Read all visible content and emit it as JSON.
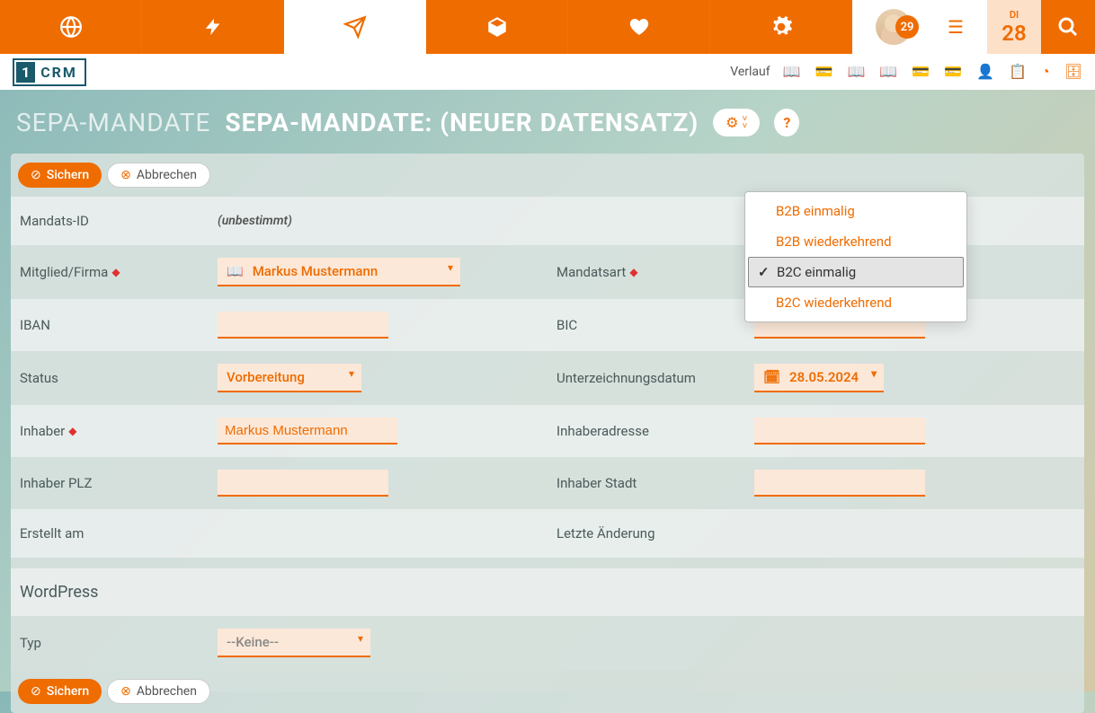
{
  "topnav": {
    "badge": "29",
    "date_dow": "DI",
    "date_day": "28"
  },
  "subbar": {
    "logo_box": "1",
    "logo_text": "CRM",
    "verlauf": "Verlauf"
  },
  "title": {
    "module": "SEPA-MANDATE",
    "record": "SEPA-MANDATE: (NEUER DATENSATZ)"
  },
  "actions": {
    "save": "Sichern",
    "cancel": "Abbrechen"
  },
  "form": {
    "mandate_id_label": "Mandats-ID",
    "mandate_id_value": "(unbestimmt)",
    "member_label": "Mitglied/Firma",
    "member_value": "Markus Mustermann",
    "mandatsart_label": "Mandatsart",
    "iban_label": "IBAN",
    "bic_label": "BIC",
    "status_label": "Status",
    "status_value": "Vorbereitung",
    "sign_date_label": "Unterzeichnungsdatum",
    "sign_date_value": "28.05.2024",
    "owner_label": "Inhaber",
    "owner_value": "Markus Mustermann",
    "owner_addr_label": "Inhaberadresse",
    "owner_plz_label": "Inhaber PLZ",
    "owner_city_label": "Inhaber Stadt",
    "created_label": "Erstellt am",
    "modified_label": "Letzte Änderung",
    "wp_section": "WordPress",
    "typ_label": "Typ",
    "typ_value": "--Keine--"
  },
  "dropdown": {
    "opt1": "B2B einmalig",
    "opt2": "B2B wiederkehrend",
    "opt3": "B2C einmalig",
    "opt4": "B2C wiederkehrend"
  }
}
